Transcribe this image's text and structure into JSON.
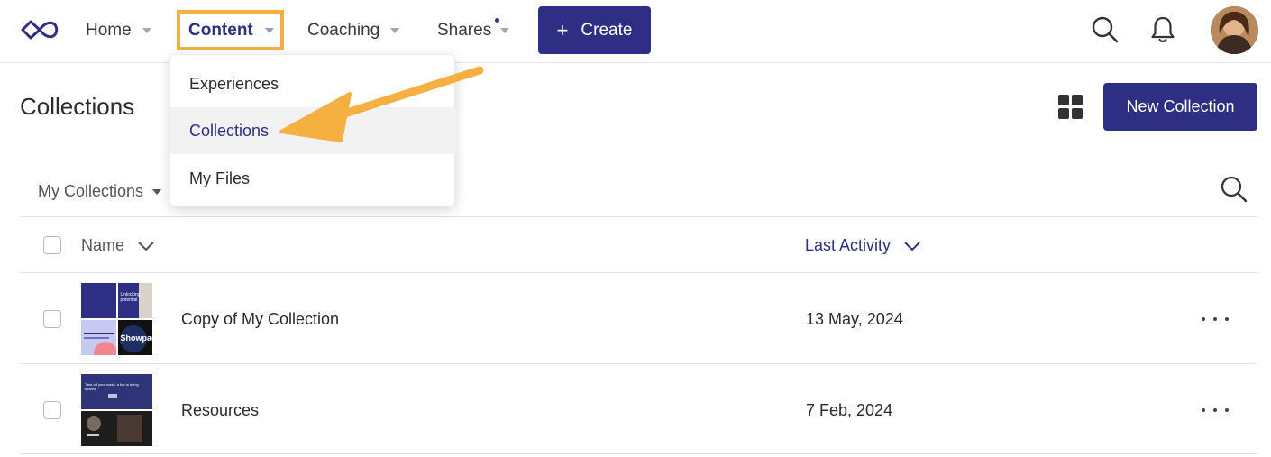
{
  "nav": {
    "home": "Home",
    "content": "Content",
    "coaching": "Coaching",
    "shares": "Shares",
    "create": "Create",
    "icons": [
      "infinity-logo-icon",
      "search-icon",
      "bell-icon",
      "avatar"
    ]
  },
  "menu": {
    "items": [
      "Experiences",
      "Collections",
      "My Files"
    ],
    "active": "Collections"
  },
  "page": {
    "title": "Collections",
    "new_button": "New Collection",
    "filter": "My Collections"
  },
  "table": {
    "columns": [
      "Name",
      "Last Activity"
    ],
    "rows": [
      {
        "name": "Copy of My Collection",
        "date": "13 May, 2024"
      },
      {
        "name": "Resources",
        "date": "7 Feb, 2024"
      }
    ]
  },
  "thumbnails": {
    "tile_text_1": "Unlocking\npotential",
    "tile_text_2": "Showpad",
    "tile_text_3": "Take off your mask: a bar is being shared"
  },
  "colors": {
    "brand": "#2e2f84",
    "highlight": "#f5b041",
    "active_bg": "#f2f2f2"
  }
}
